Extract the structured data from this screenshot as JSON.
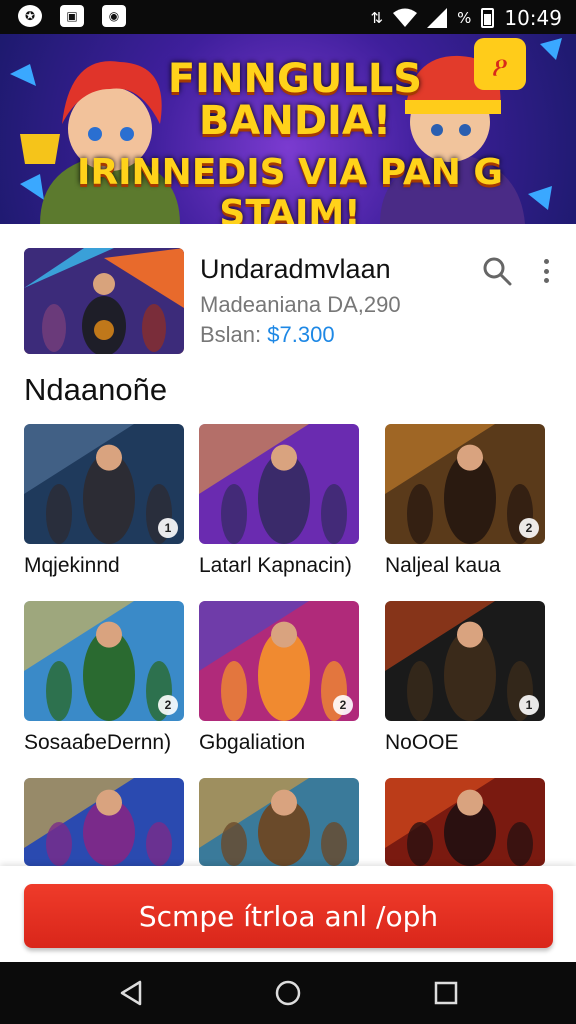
{
  "status_bar": {
    "time": "10:49",
    "signal_text": "%",
    "left_icons": [
      "app-icon",
      "gallery-icon",
      "chat-icon"
    ],
    "right_icons": [
      "data-icon",
      "wifi-icon",
      "signal-icon",
      "battery-icon"
    ]
  },
  "banner": {
    "line1": "FINNGULLS",
    "line2": "BANDIA!",
    "line3": "IRINNEDIS VIA PAN G STAIM!",
    "colors": {
      "text": "#ffd21a",
      "bg": "#3f1f9c"
    }
  },
  "featured": {
    "title": "Undaradmvlaan",
    "subtitle": "Madeaniana DA,290",
    "price_label": "Bslan:",
    "price_value": "$7.300",
    "price_color": "#1e88e5"
  },
  "section": {
    "title": "Ndaanoñe"
  },
  "games": [
    {
      "label": "Mqjekinnd",
      "badge": "1"
    },
    {
      "label": "Latarl Kapnacin)",
      "badge": ""
    },
    {
      "label": "Naljeal kaua",
      "badge": "2"
    },
    {
      "label": "SosaaɓeDernn)",
      "badge": "2"
    },
    {
      "label": "Gbgaliation",
      "badge": "2"
    },
    {
      "label": "NoOOE",
      "badge": "1"
    },
    {
      "label": "",
      "badge": ""
    },
    {
      "label": "",
      "badge": ""
    },
    {
      "label": "",
      "badge": ""
    }
  ],
  "cta": {
    "label": "Scmpe ítrloa anl /oph",
    "color": "#e2301f"
  },
  "nav": [
    "back-icon",
    "home-icon",
    "recents-icon"
  ]
}
